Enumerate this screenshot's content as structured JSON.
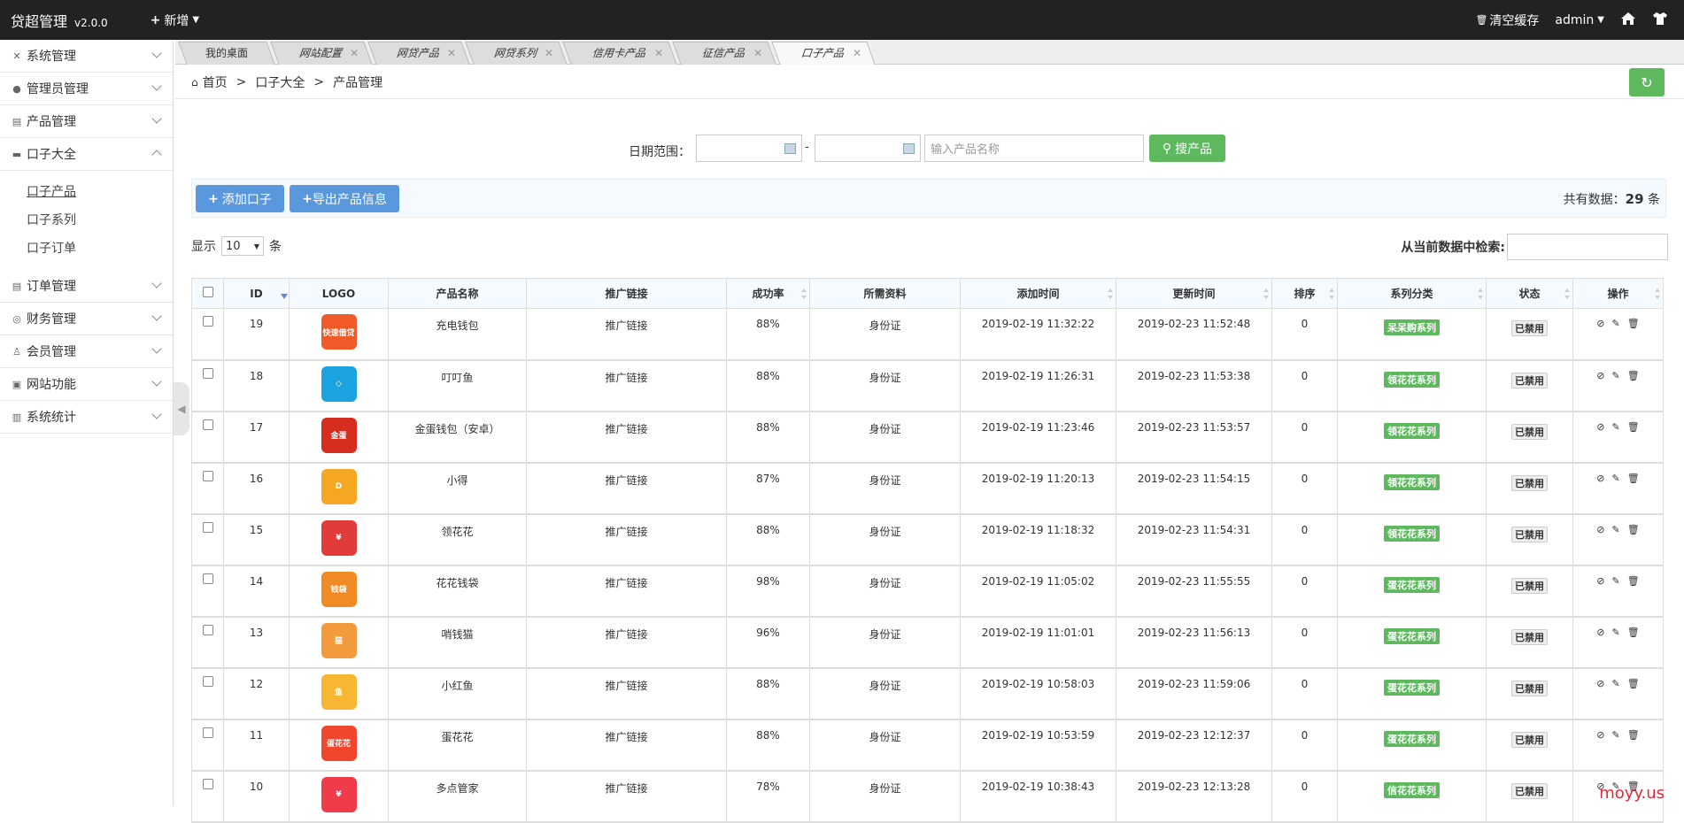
{
  "header": {
    "brand": "贷超管理",
    "version": "v2.0.0",
    "new_label": "新增",
    "clear_cache": "清空缓存",
    "user": "admin"
  },
  "sidebar": {
    "items": [
      {
        "label": "系统管理"
      },
      {
        "label": "管理员管理"
      },
      {
        "label": "产品管理"
      },
      {
        "label": "口子大全"
      },
      {
        "label": "订单管理"
      },
      {
        "label": "财务管理"
      },
      {
        "label": "会员管理"
      },
      {
        "label": "网站功能"
      },
      {
        "label": "系统统计"
      }
    ],
    "subitems": [
      {
        "label": "口子产品"
      },
      {
        "label": "口子系列"
      },
      {
        "label": "口子订单"
      }
    ]
  },
  "tabs": [
    {
      "label": "我的桌面"
    },
    {
      "label": "网站配置"
    },
    {
      "label": "网贷产品"
    },
    {
      "label": "网贷系列"
    },
    {
      "label": "信用卡产品"
    },
    {
      "label": "征信产品"
    },
    {
      "label": "口子产品"
    }
  ],
  "breadcrumb": {
    "home": "首页",
    "section": "口子大全",
    "page": "产品管理"
  },
  "search": {
    "date_label": "日期范围：",
    "dash": "-",
    "name_placeholder": "输入产品名称",
    "search_button": "搜产品"
  },
  "actions": {
    "add": "添加口子",
    "export": "导出产品信息",
    "total_prefix": "共有数据：",
    "total_count": "29",
    "total_suffix": "条"
  },
  "list_controls": {
    "show": "显示",
    "page_size": "10",
    "unit": "条",
    "filter_label": "从当前数据中检索:"
  },
  "table": {
    "headers": [
      "ID",
      "LOGO",
      "产品名称",
      "推广链接",
      "成功率",
      "所需资料",
      "添加时间",
      "更新时间",
      "排序",
      "系列分类",
      "状态",
      "操作"
    ],
    "rows": [
      {
        "id": "19",
        "name": "充电钱包",
        "link": "推广链接",
        "rate": "88%",
        "docs": "身份证",
        "added": "2019-02-19 11:32:22",
        "updated": "2019-02-23 11:52:48",
        "sort": "0",
        "series": "呆呆购系列",
        "status": "已禁用",
        "logo_color": "#f05a28",
        "logo_text": "快速借贷"
      },
      {
        "id": "18",
        "name": "叮叮鱼",
        "link": "推广链接",
        "rate": "88%",
        "docs": "身份证",
        "added": "2019-02-19 11:26:31",
        "updated": "2019-02-23 11:53:38",
        "sort": "0",
        "series": "领花花系列",
        "status": "已禁用",
        "logo_color": "#1aa3e0",
        "logo_text": "◇"
      },
      {
        "id": "17",
        "name": "金蛋钱包（安卓）",
        "link": "推广链接",
        "rate": "88%",
        "docs": "身份证",
        "added": "2019-02-19 11:23:46",
        "updated": "2019-02-23 11:53:57",
        "sort": "0",
        "series": "领花花系列",
        "status": "已禁用",
        "logo_color": "#d62d1e",
        "logo_text": "金蛋"
      },
      {
        "id": "16",
        "name": "小得",
        "link": "推广链接",
        "rate": "87%",
        "docs": "身份证",
        "added": "2019-02-19 11:20:13",
        "updated": "2019-02-23 11:54:15",
        "sort": "0",
        "series": "领花花系列",
        "status": "已禁用",
        "logo_color": "#f5a623",
        "logo_text": "D"
      },
      {
        "id": "15",
        "name": "领花花",
        "link": "推广链接",
        "rate": "88%",
        "docs": "身份证",
        "added": "2019-02-19 11:18:32",
        "updated": "2019-02-23 11:54:31",
        "sort": "0",
        "series": "领花花系列",
        "status": "已禁用",
        "logo_color": "#e23b3b",
        "logo_text": "¥"
      },
      {
        "id": "14",
        "name": "花花钱袋",
        "link": "推广链接",
        "rate": "98%",
        "docs": "身份证",
        "added": "2019-02-19 11:05:02",
        "updated": "2019-02-23 11:55:55",
        "sort": "0",
        "series": "蛋花花系列",
        "status": "已禁用",
        "logo_color": "#f08a24",
        "logo_text": "钱袋"
      },
      {
        "id": "13",
        "name": "哨钱猫",
        "link": "推广链接",
        "rate": "96%",
        "docs": "身份证",
        "added": "2019-02-19 11:01:01",
        "updated": "2019-02-23 11:56:13",
        "sort": "0",
        "series": "蛋花花系列",
        "status": "已禁用",
        "logo_color": "#f39a3c",
        "logo_text": "猫"
      },
      {
        "id": "12",
        "name": "小红鱼",
        "link": "推广链接",
        "rate": "88%",
        "docs": "身份证",
        "added": "2019-02-19 10:58:03",
        "updated": "2019-02-23 11:59:06",
        "sort": "0",
        "series": "蛋花花系列",
        "status": "已禁用",
        "logo_color": "#f7b733",
        "logo_text": "鱼"
      },
      {
        "id": "11",
        "name": "蛋花花",
        "link": "推广链接",
        "rate": "88%",
        "docs": "身份证",
        "added": "2019-02-19 10:53:59",
        "updated": "2019-02-23 12:12:37",
        "sort": "0",
        "series": "蛋花花系列",
        "status": "已禁用",
        "logo_color": "#f0472c",
        "logo_text": "蛋花花"
      },
      {
        "id": "10",
        "name": "多点管家",
        "link": "推广链接",
        "rate": "78%",
        "docs": "身份证",
        "added": "2019-02-19 10:38:43",
        "updated": "2019-02-23 12:13:28",
        "sort": "0",
        "series": "信花花系列",
        "status": "已禁用",
        "logo_color": "#ef3b4a",
        "logo_text": "¥"
      }
    ]
  },
  "watermark": "moyy.us"
}
